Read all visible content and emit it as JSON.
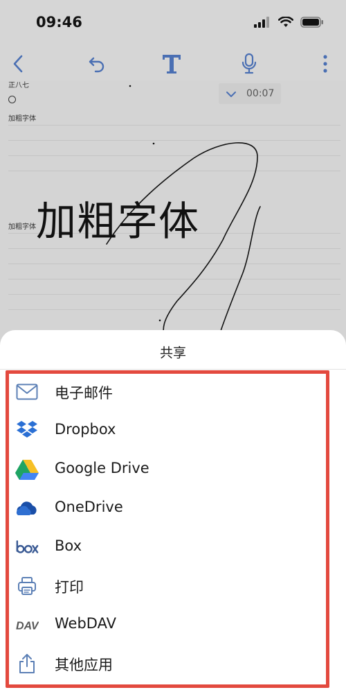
{
  "status_bar": {
    "time": "09:46"
  },
  "note": {
    "cut_text": "正八七",
    "label_top": "加粗字体",
    "label_middle": "加粗字体",
    "bold_text": "加粗字体",
    "audio_time": "00:07"
  },
  "sheet": {
    "title": "共享",
    "items": [
      {
        "label": "电子邮件",
        "icon": "mail-icon"
      },
      {
        "label": "Dropbox",
        "icon": "dropbox-icon"
      },
      {
        "label": "Google Drive",
        "icon": "google-drive-icon"
      },
      {
        "label": "OneDrive",
        "icon": "onedrive-icon"
      },
      {
        "label": "Box",
        "icon": "box-icon"
      },
      {
        "label": "打印",
        "icon": "print-icon"
      },
      {
        "label": "WebDAV",
        "icon": "webdav-icon"
      },
      {
        "label": "其他应用",
        "icon": "share-icon"
      }
    ]
  },
  "colors": {
    "accent_blue": "#4a6fb3",
    "highlight_red": "#e3493e",
    "icon_blue": "#2a6fd4"
  }
}
